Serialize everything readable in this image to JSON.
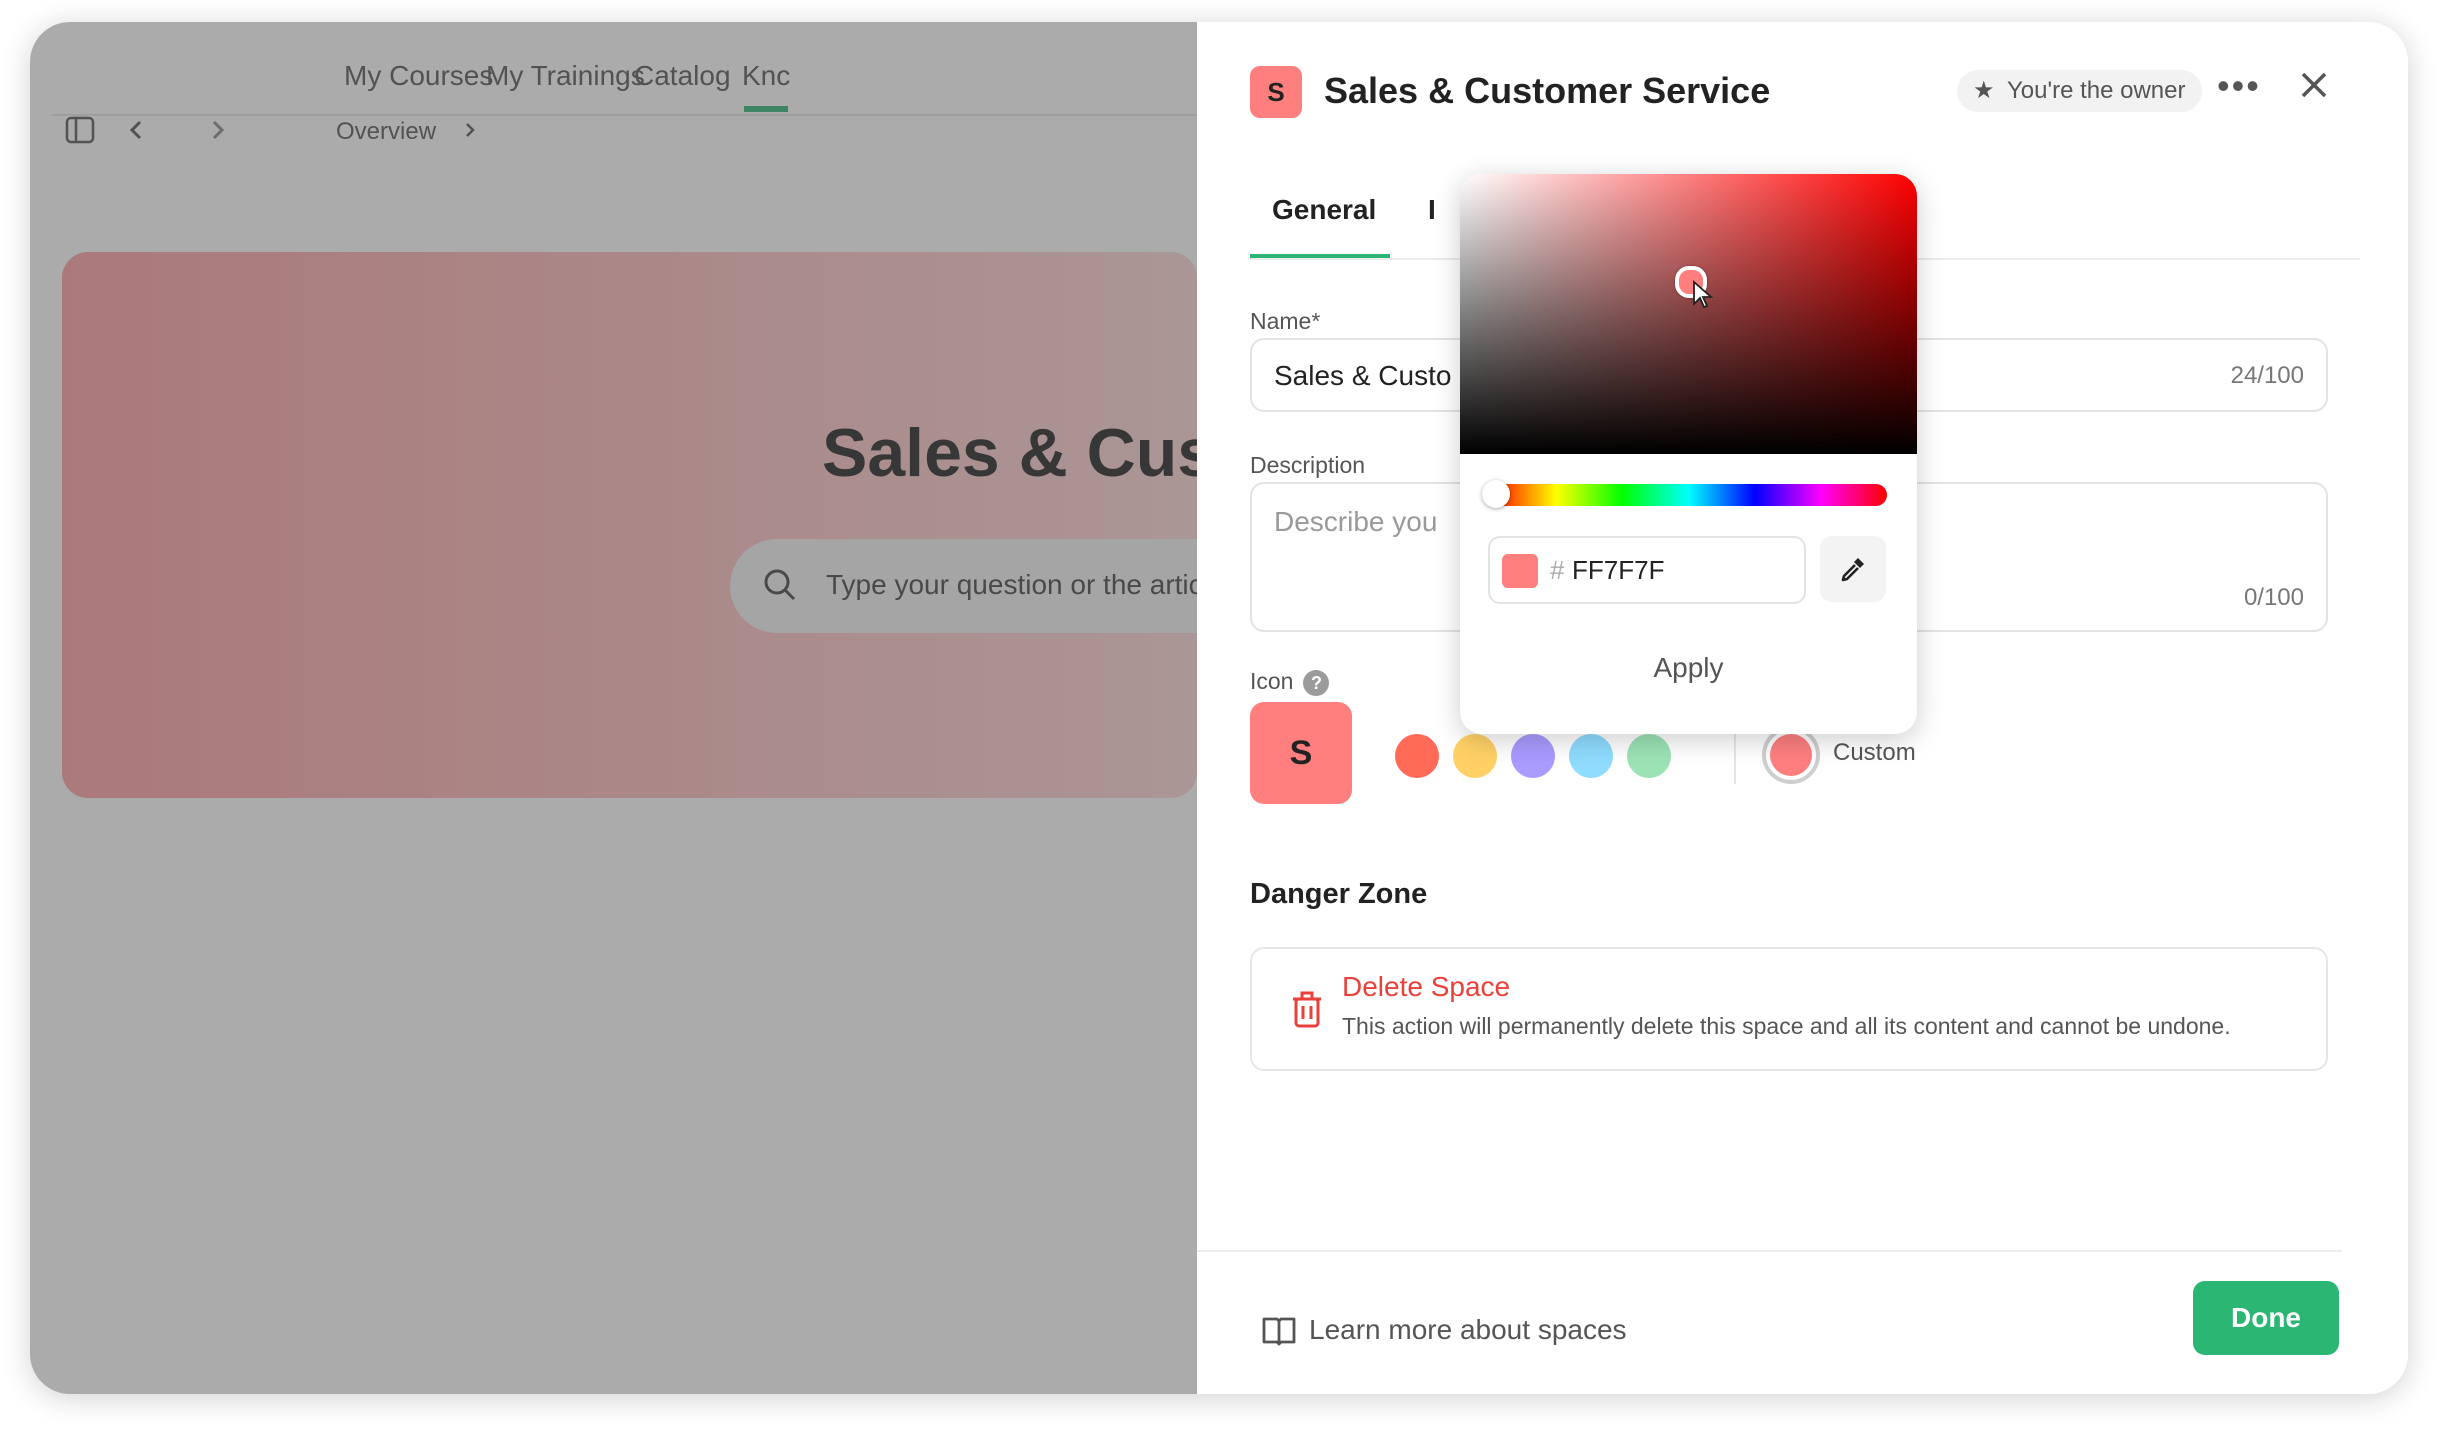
{
  "topnav": {
    "items": [
      "My Courses",
      "My Trainings",
      "Catalog",
      "Knc"
    ]
  },
  "breadcrumb": {
    "overview": "Overview"
  },
  "hero": {
    "title": "Sales & Cust",
    "search_placeholder": "Type your question or the artic"
  },
  "panel": {
    "badge_letter": "S",
    "title": "Sales & Customer Service",
    "owner_label": "You're the owner",
    "more_icon": "more-dots-icon",
    "close_icon": "close-icon",
    "tabs": [
      "General",
      "I"
    ],
    "name_label": "Name*",
    "name_value": "Sales & Custo",
    "name_count": "24/100",
    "description_label": "Description",
    "description_placeholder": "Describe you",
    "description_count": "0/100",
    "icon_label": "Icon",
    "icon_help": "?",
    "icon_letter": "S",
    "swatches": [
      "#ff6b57",
      "#ffd166",
      "#a99bff",
      "#8fdcff",
      "#9be3b5"
    ],
    "custom_color": "#FF7F7F",
    "custom_label": "Custom",
    "danger_title": "Danger Zone",
    "delete_title": "Delete Space",
    "delete_desc": "This action will permanently delete this space and all its content and cannot be undone.",
    "learn_more": "Learn more about spaces",
    "done_label": "Done"
  },
  "picker": {
    "hash": "#",
    "hex_value": "FF7F7F",
    "apply_label": "Apply"
  },
  "colors": {
    "accent_green": "#2bb673",
    "brand_coral": "#ff7f7f",
    "danger_red": "#e8413a"
  }
}
